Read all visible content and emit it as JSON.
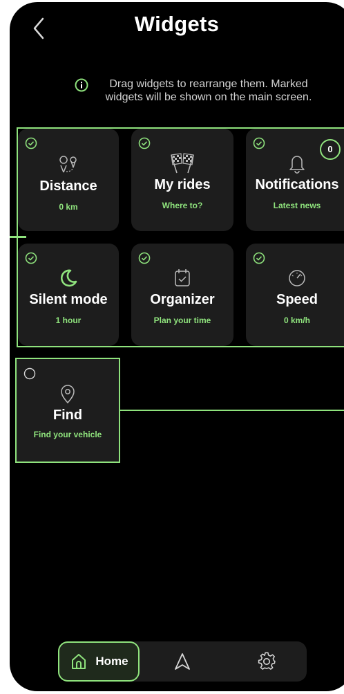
{
  "header": {
    "title": "Widgets"
  },
  "info": {
    "text": "Drag widgets to rearrange them. Marked widgets will be shown on the main screen."
  },
  "widgets": [
    {
      "name": "Distance",
      "subtitle": "0 km",
      "icon": "route-pin-icon",
      "checked": true
    },
    {
      "name": "My rides",
      "subtitle": "Where to?",
      "icon": "checkered-flags-icon",
      "checked": true
    },
    {
      "name": "Notifications",
      "subtitle": "Latest news",
      "icon": "bell-icon",
      "checked": true,
      "badge": "0"
    },
    {
      "name": "Silent mode",
      "subtitle": "1 hour",
      "icon": "moon-icon",
      "checked": true
    },
    {
      "name": "Organizer",
      "subtitle": "Plan your time",
      "icon": "calendar-check-icon",
      "checked": true
    },
    {
      "name": "Speed",
      "subtitle": "0 km/h",
      "icon": "speedometer-icon",
      "checked": true
    }
  ],
  "unselected": [
    {
      "name": "Find",
      "subtitle": "Find your vehicle",
      "icon": "location-pin-icon",
      "checked": false
    }
  ],
  "nav": {
    "home_label": "Home",
    "items": [
      "home-icon",
      "navigate-arrow-icon",
      "settings-gear-icon"
    ]
  },
  "colors": {
    "accent": "#8fe37d",
    "background": "#000000",
    "tile": "#1d1d1d"
  }
}
